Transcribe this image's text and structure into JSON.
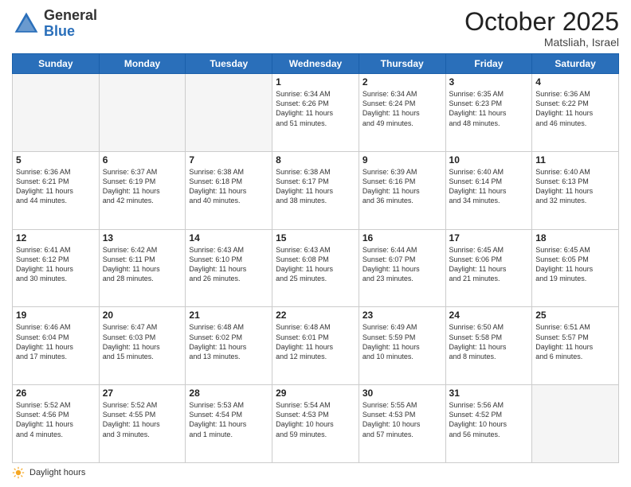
{
  "logo": {
    "general": "General",
    "blue": "Blue"
  },
  "header": {
    "month": "October 2025",
    "location": "Matsliah, Israel"
  },
  "days_of_week": [
    "Sunday",
    "Monday",
    "Tuesday",
    "Wednesday",
    "Thursday",
    "Friday",
    "Saturday"
  ],
  "weeks": [
    [
      {
        "day": "",
        "info": ""
      },
      {
        "day": "",
        "info": ""
      },
      {
        "day": "",
        "info": ""
      },
      {
        "day": "1",
        "info": "Sunrise: 6:34 AM\nSunset: 6:26 PM\nDaylight: 11 hours\nand 51 minutes."
      },
      {
        "day": "2",
        "info": "Sunrise: 6:34 AM\nSunset: 6:24 PM\nDaylight: 11 hours\nand 49 minutes."
      },
      {
        "day": "3",
        "info": "Sunrise: 6:35 AM\nSunset: 6:23 PM\nDaylight: 11 hours\nand 48 minutes."
      },
      {
        "day": "4",
        "info": "Sunrise: 6:36 AM\nSunset: 6:22 PM\nDaylight: 11 hours\nand 46 minutes."
      }
    ],
    [
      {
        "day": "5",
        "info": "Sunrise: 6:36 AM\nSunset: 6:21 PM\nDaylight: 11 hours\nand 44 minutes."
      },
      {
        "day": "6",
        "info": "Sunrise: 6:37 AM\nSunset: 6:19 PM\nDaylight: 11 hours\nand 42 minutes."
      },
      {
        "day": "7",
        "info": "Sunrise: 6:38 AM\nSunset: 6:18 PM\nDaylight: 11 hours\nand 40 minutes."
      },
      {
        "day": "8",
        "info": "Sunrise: 6:38 AM\nSunset: 6:17 PM\nDaylight: 11 hours\nand 38 minutes."
      },
      {
        "day": "9",
        "info": "Sunrise: 6:39 AM\nSunset: 6:16 PM\nDaylight: 11 hours\nand 36 minutes."
      },
      {
        "day": "10",
        "info": "Sunrise: 6:40 AM\nSunset: 6:14 PM\nDaylight: 11 hours\nand 34 minutes."
      },
      {
        "day": "11",
        "info": "Sunrise: 6:40 AM\nSunset: 6:13 PM\nDaylight: 11 hours\nand 32 minutes."
      }
    ],
    [
      {
        "day": "12",
        "info": "Sunrise: 6:41 AM\nSunset: 6:12 PM\nDaylight: 11 hours\nand 30 minutes."
      },
      {
        "day": "13",
        "info": "Sunrise: 6:42 AM\nSunset: 6:11 PM\nDaylight: 11 hours\nand 28 minutes."
      },
      {
        "day": "14",
        "info": "Sunrise: 6:43 AM\nSunset: 6:10 PM\nDaylight: 11 hours\nand 26 minutes."
      },
      {
        "day": "15",
        "info": "Sunrise: 6:43 AM\nSunset: 6:08 PM\nDaylight: 11 hours\nand 25 minutes."
      },
      {
        "day": "16",
        "info": "Sunrise: 6:44 AM\nSunset: 6:07 PM\nDaylight: 11 hours\nand 23 minutes."
      },
      {
        "day": "17",
        "info": "Sunrise: 6:45 AM\nSunset: 6:06 PM\nDaylight: 11 hours\nand 21 minutes."
      },
      {
        "day": "18",
        "info": "Sunrise: 6:45 AM\nSunset: 6:05 PM\nDaylight: 11 hours\nand 19 minutes."
      }
    ],
    [
      {
        "day": "19",
        "info": "Sunrise: 6:46 AM\nSunset: 6:04 PM\nDaylight: 11 hours\nand 17 minutes."
      },
      {
        "day": "20",
        "info": "Sunrise: 6:47 AM\nSunset: 6:03 PM\nDaylight: 11 hours\nand 15 minutes."
      },
      {
        "day": "21",
        "info": "Sunrise: 6:48 AM\nSunset: 6:02 PM\nDaylight: 11 hours\nand 13 minutes."
      },
      {
        "day": "22",
        "info": "Sunrise: 6:48 AM\nSunset: 6:01 PM\nDaylight: 11 hours\nand 12 minutes."
      },
      {
        "day": "23",
        "info": "Sunrise: 6:49 AM\nSunset: 5:59 PM\nDaylight: 11 hours\nand 10 minutes."
      },
      {
        "day": "24",
        "info": "Sunrise: 6:50 AM\nSunset: 5:58 PM\nDaylight: 11 hours\nand 8 minutes."
      },
      {
        "day": "25",
        "info": "Sunrise: 6:51 AM\nSunset: 5:57 PM\nDaylight: 11 hours\nand 6 minutes."
      }
    ],
    [
      {
        "day": "26",
        "info": "Sunrise: 5:52 AM\nSunset: 4:56 PM\nDaylight: 11 hours\nand 4 minutes."
      },
      {
        "day": "27",
        "info": "Sunrise: 5:52 AM\nSunset: 4:55 PM\nDaylight: 11 hours\nand 3 minutes."
      },
      {
        "day": "28",
        "info": "Sunrise: 5:53 AM\nSunset: 4:54 PM\nDaylight: 11 hours\nand 1 minute."
      },
      {
        "day": "29",
        "info": "Sunrise: 5:54 AM\nSunset: 4:53 PM\nDaylight: 10 hours\nand 59 minutes."
      },
      {
        "day": "30",
        "info": "Sunrise: 5:55 AM\nSunset: 4:53 PM\nDaylight: 10 hours\nand 57 minutes."
      },
      {
        "day": "31",
        "info": "Sunrise: 5:56 AM\nSunset: 4:52 PM\nDaylight: 10 hours\nand 56 minutes."
      },
      {
        "day": "",
        "info": ""
      }
    ]
  ],
  "footer": {
    "daylight_hours": "Daylight hours"
  }
}
